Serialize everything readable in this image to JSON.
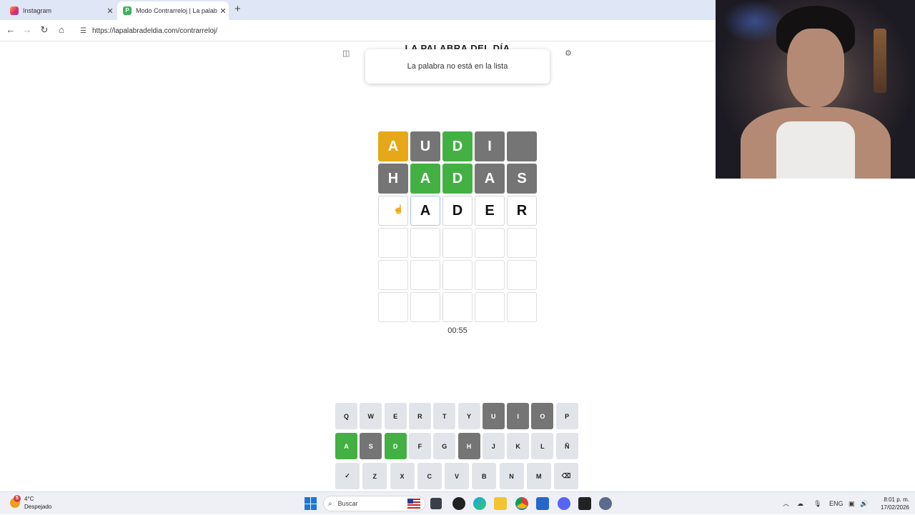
{
  "browser": {
    "tabs": [
      {
        "title": "Instagram",
        "active": false
      },
      {
        "title": "Modo Contrarreloj | La palabra",
        "active": true
      }
    ],
    "url": "https://lapalabradeldia.com/contrarreloj/"
  },
  "page": {
    "site_title": "LA PALABRA DEL DÍA",
    "toast": "La palabra no está en la lista",
    "timer": "00:55"
  },
  "board": {
    "rows": [
      [
        {
          "l": "A",
          "s": "present"
        },
        {
          "l": "U",
          "s": "absent"
        },
        {
          "l": "D",
          "s": "correct"
        },
        {
          "l": "I",
          "s": "absent"
        },
        {
          "l": "",
          "s": "absent"
        }
      ],
      [
        {
          "l": "H",
          "s": "absent"
        },
        {
          "l": "A",
          "s": "correct"
        },
        {
          "l": "D",
          "s": "correct"
        },
        {
          "l": "A",
          "s": "absent"
        },
        {
          "l": "S",
          "s": "absent"
        }
      ],
      [
        {
          "l": "",
          "s": "typed"
        },
        {
          "l": "A",
          "s": "active"
        },
        {
          "l": "D",
          "s": "typed"
        },
        {
          "l": "E",
          "s": "typed"
        },
        {
          "l": "R",
          "s": "typed"
        }
      ],
      [
        {
          "l": "",
          "s": "empty"
        },
        {
          "l": "",
          "s": "empty"
        },
        {
          "l": "",
          "s": "empty"
        },
        {
          "l": "",
          "s": "empty"
        },
        {
          "l": "",
          "s": "empty"
        }
      ],
      [
        {
          "l": "",
          "s": "empty"
        },
        {
          "l": "",
          "s": "empty"
        },
        {
          "l": "",
          "s": "empty"
        },
        {
          "l": "",
          "s": "empty"
        },
        {
          "l": "",
          "s": "empty"
        }
      ],
      [
        {
          "l": "",
          "s": "empty"
        },
        {
          "l": "",
          "s": "empty"
        },
        {
          "l": "",
          "s": "empty"
        },
        {
          "l": "",
          "s": "empty"
        },
        {
          "l": "",
          "s": "empty"
        }
      ]
    ]
  },
  "keyboard": {
    "rows": [
      [
        {
          "k": "Q",
          "s": ""
        },
        {
          "k": "W",
          "s": ""
        },
        {
          "k": "E",
          "s": ""
        },
        {
          "k": "R",
          "s": ""
        },
        {
          "k": "T",
          "s": ""
        },
        {
          "k": "Y",
          "s": ""
        },
        {
          "k": "U",
          "s": "absent"
        },
        {
          "k": "I",
          "s": "absent"
        },
        {
          "k": "O",
          "s": "absent"
        },
        {
          "k": "P",
          "s": ""
        }
      ],
      [
        {
          "k": "A",
          "s": "correct"
        },
        {
          "k": "S",
          "s": "absent"
        },
        {
          "k": "D",
          "s": "correct"
        },
        {
          "k": "F",
          "s": ""
        },
        {
          "k": "G",
          "s": ""
        },
        {
          "k": "H",
          "s": "absent"
        },
        {
          "k": "J",
          "s": ""
        },
        {
          "k": "K",
          "s": ""
        },
        {
          "k": "L",
          "s": ""
        },
        {
          "k": "Ñ",
          "s": ""
        }
      ],
      [
        {
          "k": "✓",
          "s": ""
        },
        {
          "k": "Z",
          "s": ""
        },
        {
          "k": "X",
          "s": ""
        },
        {
          "k": "C",
          "s": ""
        },
        {
          "k": "V",
          "s": ""
        },
        {
          "k": "B",
          "s": ""
        },
        {
          "k": "N",
          "s": ""
        },
        {
          "k": "M",
          "s": ""
        },
        {
          "k": "⌫",
          "s": ""
        }
      ]
    ]
  },
  "taskbar": {
    "weather_temp": "4°C",
    "weather_desc": "Despejado",
    "weather_badge": "5",
    "search_placeholder": "Buscar",
    "lang": "ENG",
    "time": "8:01 p. m.",
    "date": "17/02/2026"
  },
  "colors": {
    "correct": "#43b043",
    "present": "#e6a818",
    "absent": "#757575",
    "key": "#e1e4e9"
  }
}
